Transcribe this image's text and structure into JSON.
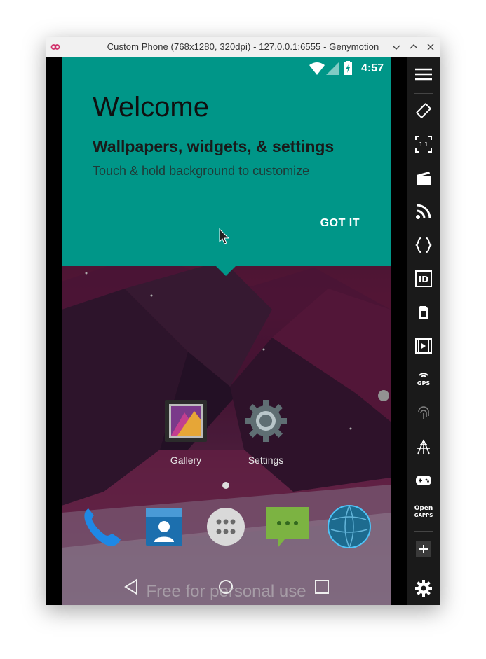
{
  "window": {
    "title": "Custom Phone (768x1280, 320dpi) - 127.0.0.1:6555 - Genymotion",
    "logo_icon": "genymotion-logo-icon"
  },
  "status_bar": {
    "time": "4:57",
    "icons": [
      "wifi-icon",
      "cell-signal-icon",
      "battery-charging-icon"
    ]
  },
  "welcome_card": {
    "title": "Welcome",
    "subtitle": "Wallpapers, widgets, & settings",
    "body": "Touch & hold background to customize",
    "dismiss_label": "GOT IT",
    "color": "#009688"
  },
  "home": {
    "apps": [
      {
        "label": "Gallery",
        "icon": "gallery-icon"
      },
      {
        "label": "Settings",
        "icon": "settings-gear-icon"
      }
    ],
    "dock": [
      "phone-icon",
      "contacts-icon",
      "app-drawer-icon",
      "messaging-icon",
      "browser-globe-icon"
    ],
    "watermark": "Free for personal use"
  },
  "toolbar": {
    "items": [
      "menu-icon",
      "rotate-icon",
      "pixel-perfect-icon",
      "capture-icon",
      "cast-icon",
      "api-braces-icon",
      "device-id-icon",
      "sim-card-icon",
      "media-player-icon",
      "gps-icon",
      "fingerprint-icon",
      "network-icon",
      "gamepad-icon",
      "open-gapps-icon",
      "add-icon",
      "settings-icon"
    ],
    "scale_label": "1:1",
    "gps_label": "GPS",
    "open_label": "Open",
    "gapps_label": "GAPPS",
    "id_label": "ID"
  }
}
